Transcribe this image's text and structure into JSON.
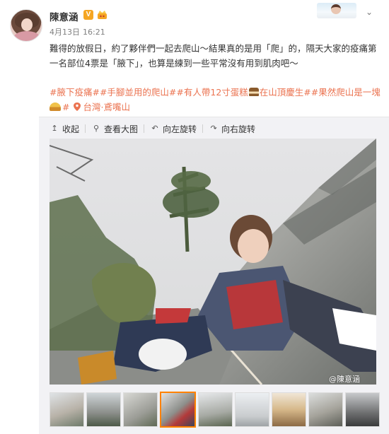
{
  "post": {
    "username": "陳意涵",
    "verified_badge": "V",
    "date": "4月13日",
    "time": "16:21",
    "text": "難得的放假日，約了夥伴們一起去爬山～結果真的是用「爬」的，隔天大家的疫痛第一名部位4票是「腋下」，也算是練到一些平常沒有用到肌肉吧～",
    "tags_line1": [
      "#腋下疫痛#",
      "#手腳並用的爬山#",
      "#有人帶12寸蛋糕",
      "在山頂慶生#",
      "#果然爬山是一塊"
    ],
    "tags_line2_end": "#",
    "location": "台灣·鳶嘴山"
  },
  "toolbar": {
    "collapse": "收起",
    "view_large": "查看大图",
    "rotate_left": "向左旋转",
    "rotate_right": "向右旋转"
  },
  "image": {
    "watermark": "@陳意涵"
  },
  "icons": {
    "menu": "chevron-down-icon",
    "collapse": "arrow-up-icon",
    "view_large": "magnify-icon",
    "rotate_left": "rotate-left-icon",
    "rotate_right": "rotate-right-icon",
    "location": "location-pin-icon"
  },
  "colors": {
    "tag": "#eb7350",
    "username": "#333333",
    "meta": "#808080",
    "badge": "#f5a623",
    "selected_thumb": "#ff8200",
    "panel": "#f2f2f5"
  }
}
